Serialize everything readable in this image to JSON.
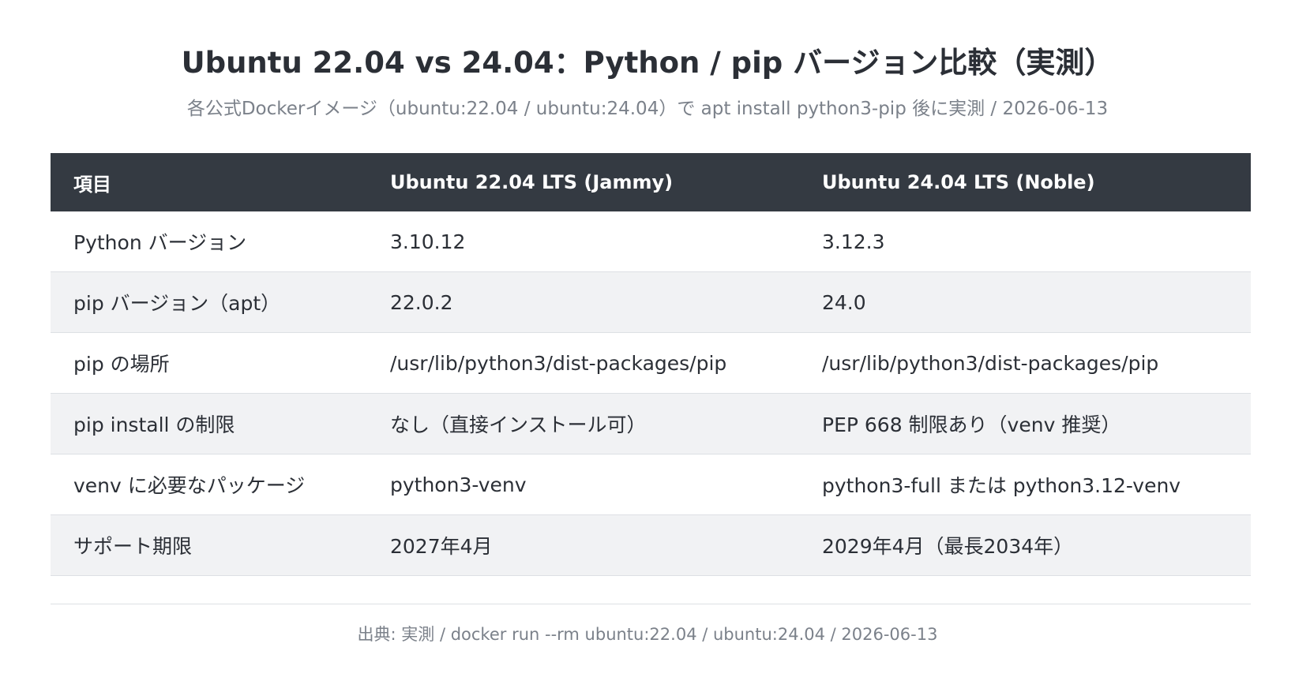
{
  "title": "Ubuntu 22.04 vs 24.04：Python / pip バージョン比較（実測）",
  "subtitle": "各公式Dockerイメージ（ubuntu:22.04 / ubuntu:24.04）で apt install python3-pip 後に実測 / 2026-06-13",
  "table": {
    "headers": [
      "項目",
      "Ubuntu 22.04 LTS (Jammy)",
      "Ubuntu 24.04 LTS (Noble)"
    ],
    "rows": [
      [
        "Python バージョン",
        "3.10.12",
        "3.12.3"
      ],
      [
        "pip バージョン（apt）",
        "22.0.2",
        "24.0"
      ],
      [
        "pip の場所",
        "/usr/lib/python3/dist-packages/pip",
        "/usr/lib/python3/dist-packages/pip"
      ],
      [
        "pip install の制限",
        "なし（直接インストール可）",
        "PEP 668 制限あり（venv 推奨）"
      ],
      [
        "venv に必要なパッケージ",
        "python3-venv",
        "python3-full または python3.12-venv"
      ],
      [
        "サポート期限",
        "2027年4月",
        "2029年4月（最長2034年）"
      ]
    ]
  },
  "source": "出典: 実測 / docker run --rm ubuntu:22.04 / ubuntu:24.04 / 2026-06-13"
}
